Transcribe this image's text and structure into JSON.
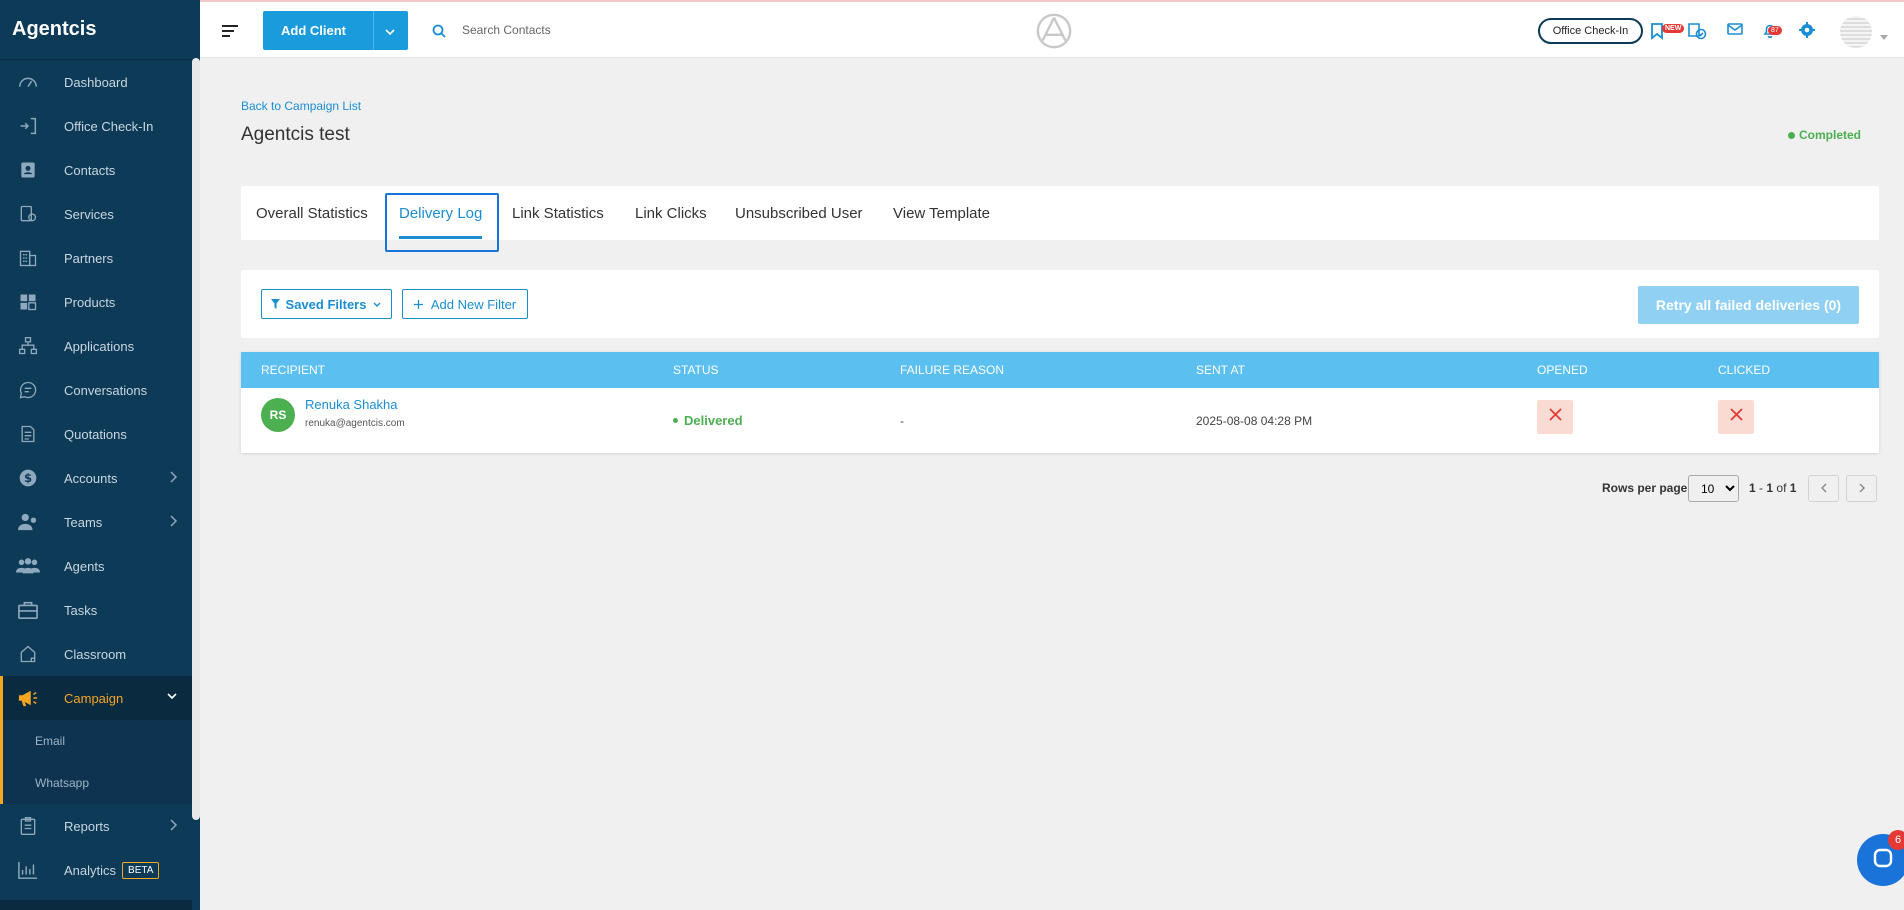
{
  "app": {
    "brand": "Agentcis"
  },
  "sidebar": {
    "items": [
      {
        "key": "dashboard",
        "label": "Dashboard",
        "icon": "gauge-icon"
      },
      {
        "key": "office-check-in",
        "label": "Office Check-In",
        "icon": "check-in-icon"
      },
      {
        "key": "contacts",
        "label": "Contacts",
        "icon": "contact-card-icon"
      },
      {
        "key": "services",
        "label": "Services",
        "icon": "services-icon"
      },
      {
        "key": "partners",
        "label": "Partners",
        "icon": "building-icon"
      },
      {
        "key": "products",
        "label": "Products",
        "icon": "products-icon"
      },
      {
        "key": "applications",
        "label": "Applications",
        "icon": "flowchart-icon"
      },
      {
        "key": "conversations",
        "label": "Conversations",
        "icon": "chat-icon"
      },
      {
        "key": "quotations",
        "label": "Quotations",
        "icon": "document-icon"
      },
      {
        "key": "accounts",
        "label": "Accounts",
        "icon": "dollar-icon"
      },
      {
        "key": "teams",
        "label": "Teams",
        "icon": "team-icon"
      },
      {
        "key": "agents",
        "label": "Agents",
        "icon": "agents-icon"
      },
      {
        "key": "tasks",
        "label": "Tasks",
        "icon": "briefcase-icon"
      },
      {
        "key": "classroom",
        "label": "Classroom",
        "icon": "classroom-icon"
      },
      {
        "key": "campaign",
        "label": "Campaign",
        "icon": "megaphone-icon"
      },
      {
        "key": "reports",
        "label": "Reports",
        "icon": "clipboard-icon"
      },
      {
        "key": "analytics",
        "label": "Analytics",
        "icon": "chart-icon",
        "badge": "BETA"
      }
    ],
    "campaign_sub": [
      "Email",
      "Whatsapp"
    ]
  },
  "header": {
    "add_client": "Add Client",
    "search_placeholder": "Search Contacts",
    "office_check_in": "Office Check-In",
    "new_badge": "NEW",
    "notification_count": "87"
  },
  "page": {
    "back_link": "Back to Campaign List",
    "title": "Agentcis test",
    "status": "Completed",
    "status_color": "#4caf50"
  },
  "tabs": [
    "Overall Statistics",
    "Delivery Log",
    "Link Statistics",
    "Link Clicks",
    "Unsubscribed User",
    "View Template"
  ],
  "filters": {
    "saved_filters": "Saved Filters",
    "add_new_filter": "Add New Filter",
    "retry": "Retry all failed deliveries (0)"
  },
  "table": {
    "columns": [
      "RECIPIENT",
      "STATUS",
      "FAILURE REASON",
      "SENT AT",
      "OPENED",
      "CLICKED"
    ],
    "rows": [
      {
        "initials": "RS",
        "name": "Renuka Shakha",
        "email": "renuka@agentcis.com",
        "status": "Delivered",
        "failure_reason": "-",
        "sent_at": "2025-08-08 04:28 PM",
        "opened": false,
        "clicked": false
      }
    ]
  },
  "pagination": {
    "rows_per_page_label": "Rows per page",
    "rows_per_page": "10",
    "range_start": "1",
    "range_end": "1",
    "of_label": "of",
    "total": "1"
  },
  "chat": {
    "badge": "6"
  },
  "colors": {
    "accent": "#1a8ed0",
    "sidebar": "#0d3a57",
    "table_header": "#5bbff0",
    "active_nav": "#f5a623"
  }
}
